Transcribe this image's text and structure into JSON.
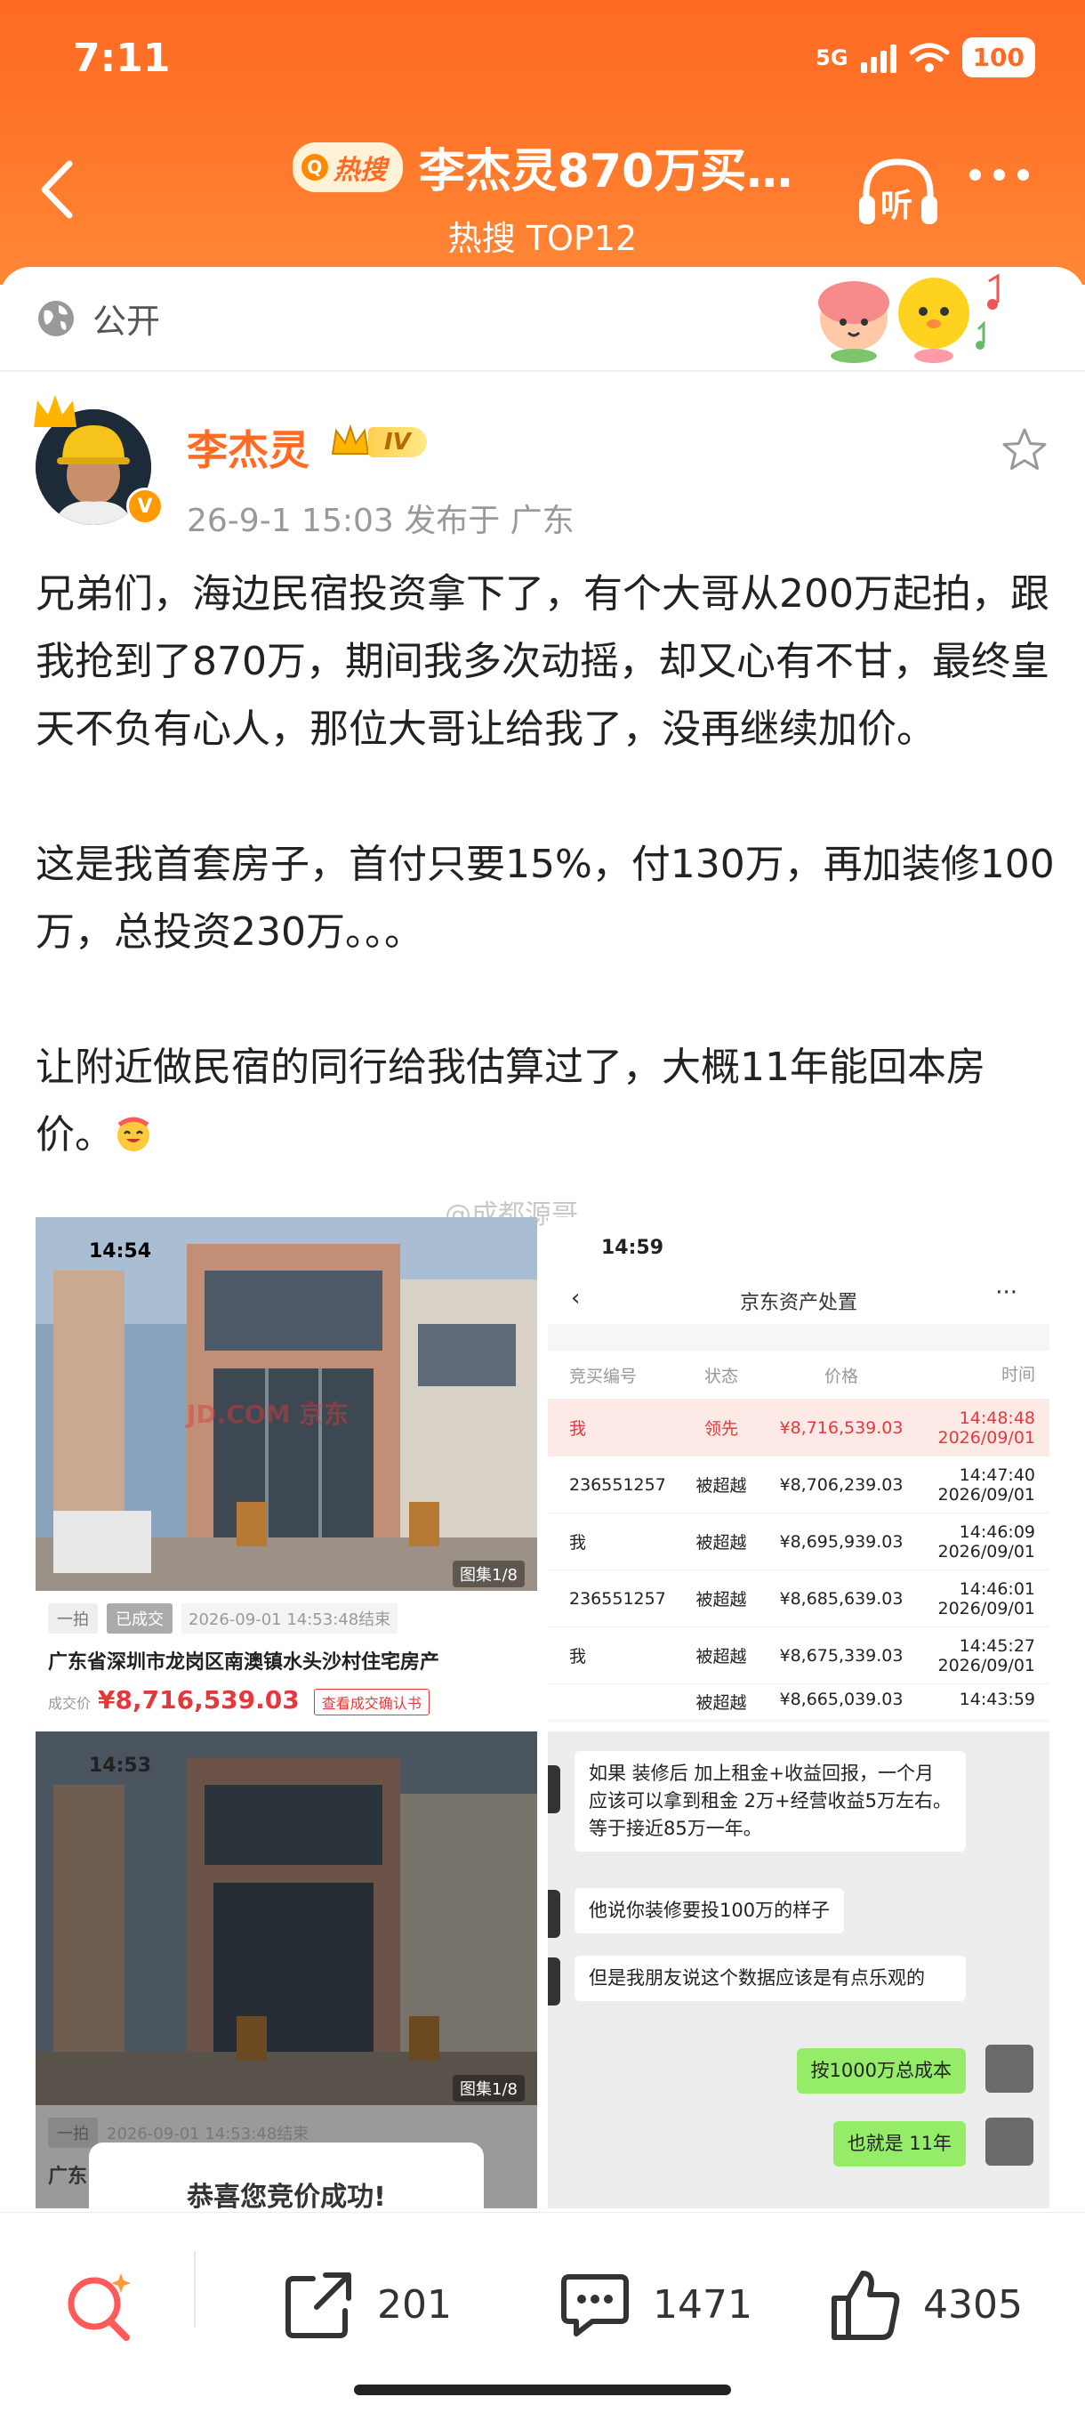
{
  "status_bar": {
    "time": "7:11",
    "network": "5G",
    "battery": "100"
  },
  "header": {
    "hot_tag": "热搜",
    "title": "李杰灵870万买…",
    "subtitle": "热搜 TOP12",
    "listen_label": "听"
  },
  "visibility": {
    "label": "公开"
  },
  "author": {
    "name": "李杰灵",
    "level": "IV",
    "meta": "26-9-1 15:03  发布于 广东"
  },
  "post": {
    "paragraphs": [
      "兄弟们，海边民宿投资拿下了，有个大哥从200万起拍，跟我抢到了870万，期间我多次动摇，却又心有不甘，最终皇天不负有心人，那位大哥让给我了，没再继续加价。",
      "这是我首套房子，首付只要15%，付130万，再加装修100万，总投资230万。。。",
      "让附近做民宿的同行给我估算过了，大概11年能回本房价。"
    ],
    "watermark": "@成都源哥"
  },
  "images": {
    "tile1": {
      "status_time": "14:54",
      "watermark": "JD.COM 京东",
      "gallery": "图集1/8",
      "tag_round": "一拍",
      "tag_done": "已成交",
      "deal_time": "2026-09-01 14:53:48结束",
      "listing_title": "广东省深圳市龙岗区南澳镇水头沙村住宅房产",
      "price_label": "成交价",
      "price": "¥8,716,539.03",
      "cert_button": "查看成交确认书"
    },
    "tile2": {
      "status_time": "14:59",
      "page_title": "京东资产处置",
      "headers": [
        "竞买编号",
        "状态",
        "价格",
        "时间"
      ],
      "rows": [
        {
          "id": "我",
          "status": "领先",
          "price": "¥8,716,539.03",
          "time": "14:48:48",
          "date": "2026/09/01"
        },
        {
          "id": "236551257",
          "status": "被超越",
          "price": "¥8,706,239.03",
          "time": "14:47:40",
          "date": "2026/09/01"
        },
        {
          "id": "我",
          "status": "被超越",
          "price": "¥8,695,939.03",
          "time": "14:46:09",
          "date": "2026/09/01"
        },
        {
          "id": "236551257",
          "status": "被超越",
          "price": "¥8,685,639.03",
          "time": "14:46:01",
          "date": "2026/09/01"
        },
        {
          "id": "我",
          "status": "被超越",
          "price": "¥8,675,339.03",
          "time": "14:45:27",
          "date": "2026/09/01"
        },
        {
          "id": "",
          "status": "被超越",
          "price": "¥8,665,039.03",
          "time": "14:43:59",
          "date": ""
        }
      ]
    },
    "tile3": {
      "status_time": "14:53",
      "gallery": "图集1/8",
      "tag_round": "一拍",
      "deal_time": "2026-09-01 14:53:48结束",
      "listing_prefix": "广东",
      "popup_text": "恭喜您竞价成功!"
    },
    "tile4": {
      "messages": [
        {
          "side": "left",
          "text": "如果 装修后 加上租金+收益回报，一个月应该可以拿到租金 2万+经营收益5万左右。等于接近85万一年。"
        },
        {
          "side": "left",
          "text": "他说你装修要投100万的样子"
        },
        {
          "side": "left",
          "text": "但是我朋友说这个数据应该是有点乐观的"
        },
        {
          "side": "right",
          "text": "按1000万总成本"
        },
        {
          "side": "right",
          "text": "也就是 11年"
        }
      ]
    }
  },
  "actions": {
    "share_count": "201",
    "comment_count": "1471",
    "like_count": "4305"
  },
  "colors": {
    "brand_orange": "#ff6a24",
    "price_red": "#e4393c",
    "chat_green": "#95ec69"
  }
}
